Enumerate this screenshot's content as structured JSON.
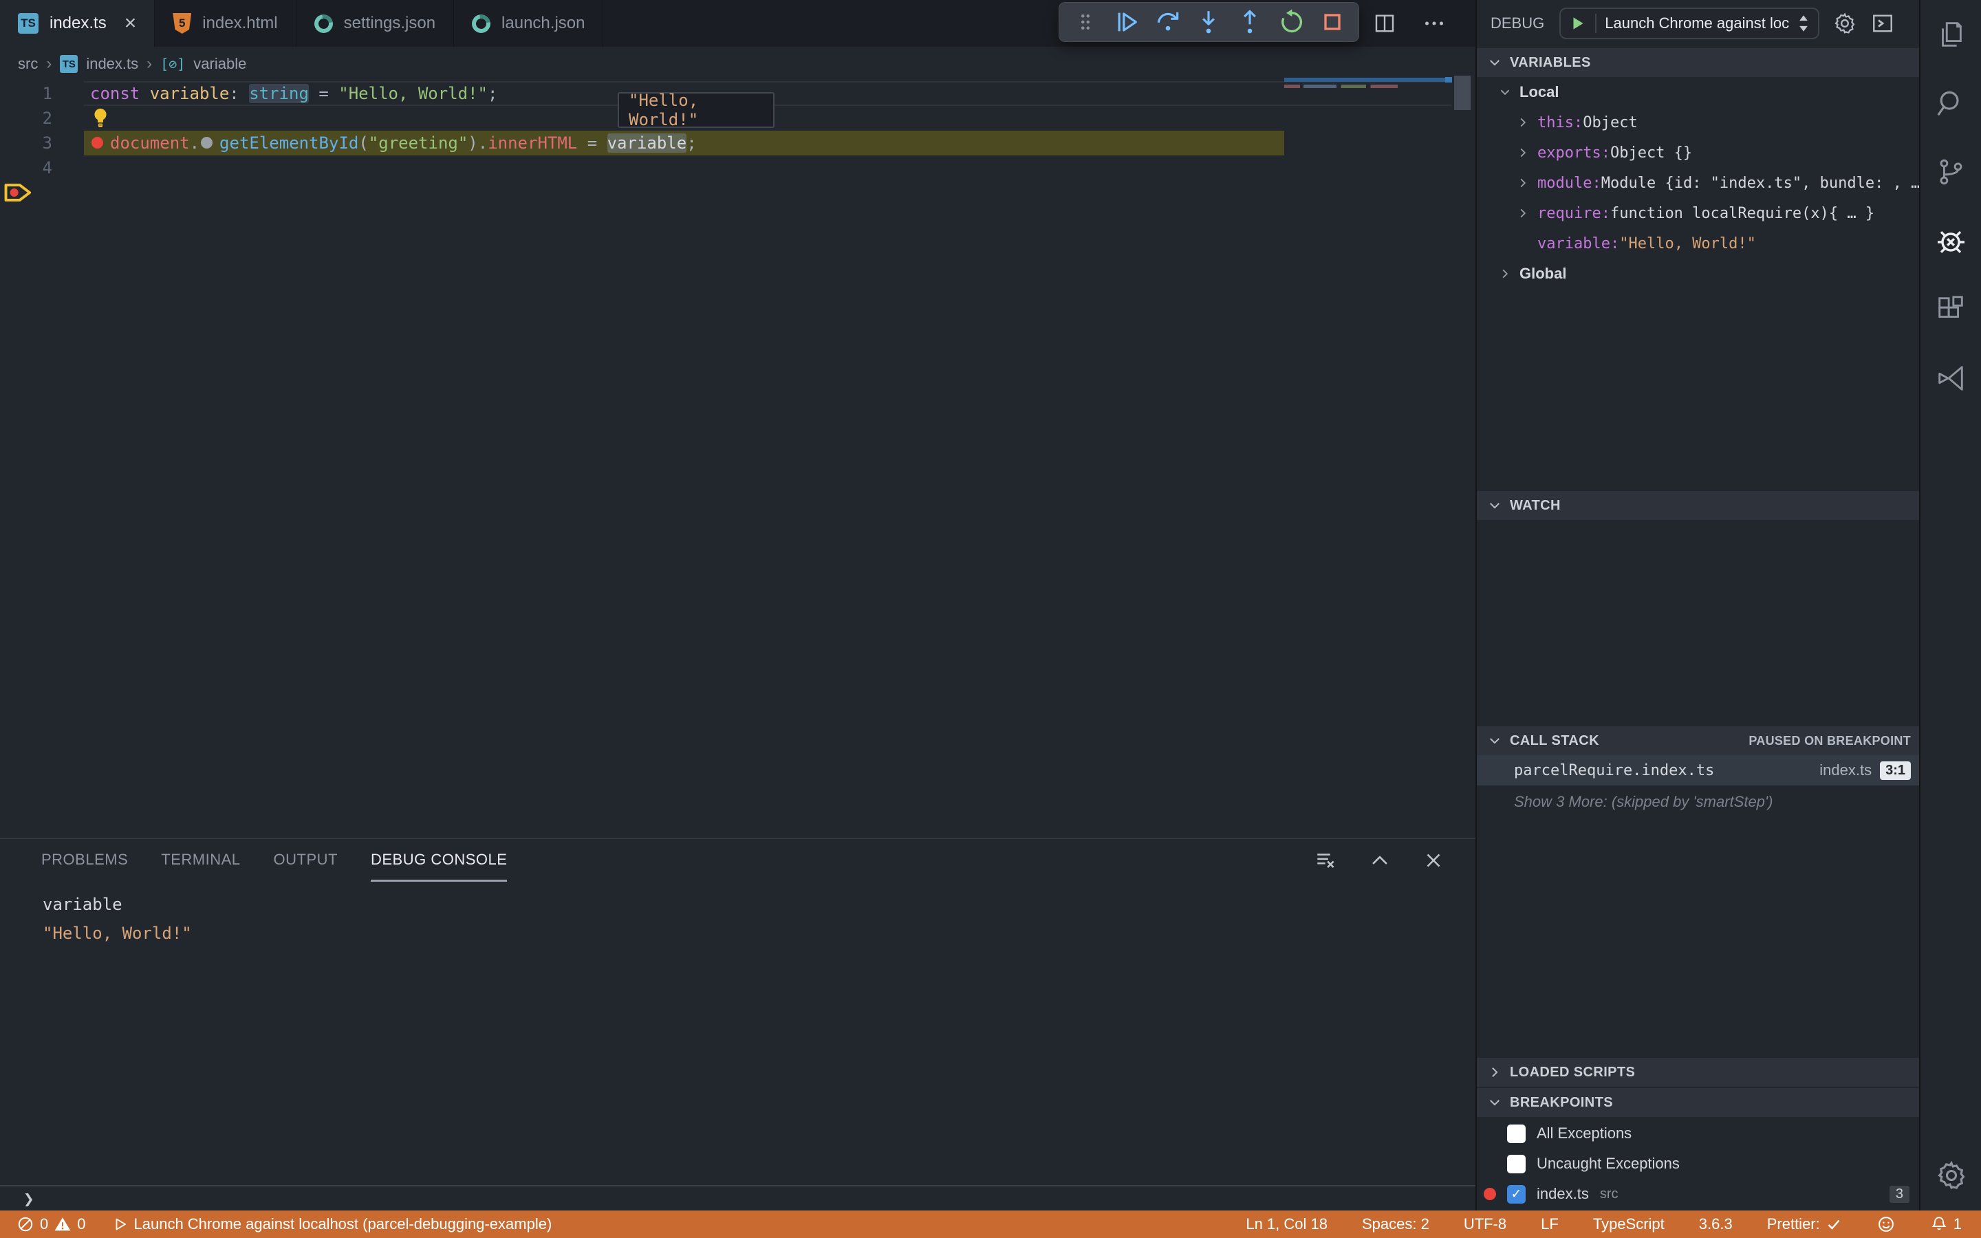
{
  "window": {
    "tabs": [
      {
        "label": "index.ts",
        "icon": "typescript",
        "active": true
      },
      {
        "label": "index.html",
        "icon": "html",
        "active": false
      },
      {
        "label": "settings.json",
        "icon": "json",
        "active": false
      },
      {
        "label": "launch.json",
        "icon": "json",
        "active": false
      }
    ],
    "editor_actions": [
      "split-editor",
      "more-actions"
    ]
  },
  "debug_toolbar": {
    "actions": [
      "drag-handle",
      "continue",
      "step-over",
      "step-into",
      "step-out",
      "restart",
      "stop"
    ]
  },
  "debug_titlebar": {
    "label": "DEBUG",
    "config": "Launch Chrome against local",
    "actions": [
      "start-debugging",
      "settings",
      "open-debug-console"
    ]
  },
  "breadcrumb": {
    "items": [
      "src",
      "index.ts",
      "variable"
    ]
  },
  "editor": {
    "lines": [
      {
        "number": "1",
        "tokens": [
          {
            "text": "const ",
            "color": "keyword"
          },
          {
            "text": "variable",
            "color": "var"
          },
          {
            "text": ": ",
            "color": "punct"
          },
          {
            "text": "string",
            "color": "type",
            "hl": 1
          },
          {
            "text": " = ",
            "color": "punct"
          },
          {
            "text": "\"Hello, World!\"",
            "color": "string"
          },
          {
            "text": ";",
            "color": "punct"
          }
        ]
      },
      {
        "number": "2"
      },
      {
        "number": "3",
        "tokens": [
          {
            "dot": "red"
          },
          {
            "text": "document",
            "color": "prop"
          },
          {
            "text": ".",
            "color": "punct"
          },
          {
            "dot": "gray"
          },
          {
            "text": "getElementById",
            "color": "func"
          },
          {
            "text": "(",
            "color": "punct"
          },
          {
            "text": "\"greeting\"",
            "color": "string"
          },
          {
            "text": ").",
            "color": "punct"
          },
          {
            "text": "innerHTML",
            "color": "prop"
          },
          {
            "text": " = ",
            "color": "punct"
          },
          {
            "text": "variable",
            "color": "fg",
            "hl": 2
          },
          {
            "text": ";",
            "color": "punct"
          }
        ]
      },
      {
        "number": "4"
      }
    ],
    "debug_tooltip": "\"Hello, World!\""
  },
  "panel": {
    "tabs": [
      "PROBLEMS",
      "TERMINAL",
      "OUTPUT",
      "DEBUG CONSOLE"
    ],
    "active_tab": "DEBUG CONSOLE",
    "output": [
      {
        "text": "variable"
      },
      {
        "text": "\"Hello, World!\""
      }
    ],
    "prompt": "❯"
  },
  "sidebar": {
    "variables": {
      "title": "VARIABLES",
      "local_label": "Local",
      "global_label": "Global",
      "items": [
        {
          "name": "this",
          "sep": ": ",
          "value": "Object"
        },
        {
          "name": "exports",
          "sep": ": ",
          "value": "Object {}"
        },
        {
          "name": "module",
          "sep": ": ",
          "value": "Module {id: \"index.ts\", bundle: , …"
        },
        {
          "name": "require",
          "sep": ": ",
          "value": "function localRequire(x){ … }"
        },
        {
          "name": "variable",
          "sep": ": ",
          "value": "\"Hello, World!\""
        }
      ]
    },
    "watch": {
      "title": "WATCH"
    },
    "call_stack": {
      "title": "CALL STACK",
      "status": "PAUSED ON BREAKPOINT",
      "frames": [
        {
          "name": "parcelRequire.index.ts",
          "file": "index.ts",
          "location": "3:1"
        }
      ],
      "more": "Show 3 More: (skipped by 'smartStep')"
    },
    "loaded_scripts": {
      "title": "LOADED SCRIPTS"
    },
    "breakpoints": {
      "title": "BREAKPOINTS",
      "items": [
        {
          "label": "All Exceptions",
          "checked": false
        },
        {
          "label": "Uncaught Exceptions",
          "checked": false
        },
        {
          "label": "index.ts",
          "detail": "src",
          "checked": true,
          "count": "3"
        }
      ]
    }
  },
  "status_bar": {
    "errors": "0",
    "warnings": "0",
    "launch_text": "Launch Chrome against localhost (parcel-debugging-example)",
    "line_col": "Ln 1, Col 18",
    "indent": "Spaces: 2",
    "encoding": "UTF-8",
    "eol": "LF",
    "language": "TypeScript",
    "ts_version": "3.6.3",
    "prettier_label": "Prettier:",
    "notification_count": "1"
  },
  "activity_bar": {
    "items": [
      "explorer",
      "search",
      "source-control",
      "debug",
      "extensions",
      "visual-studio",
      "settings"
    ]
  },
  "colors": {
    "status_bar": "#c96b31",
    "debug_line_bg": "#4b4a20",
    "accent_blue": "#75beff",
    "breakpoint_red": "#e8443c",
    "restart_green": "#89d185",
    "stop_red": "#f48771"
  }
}
